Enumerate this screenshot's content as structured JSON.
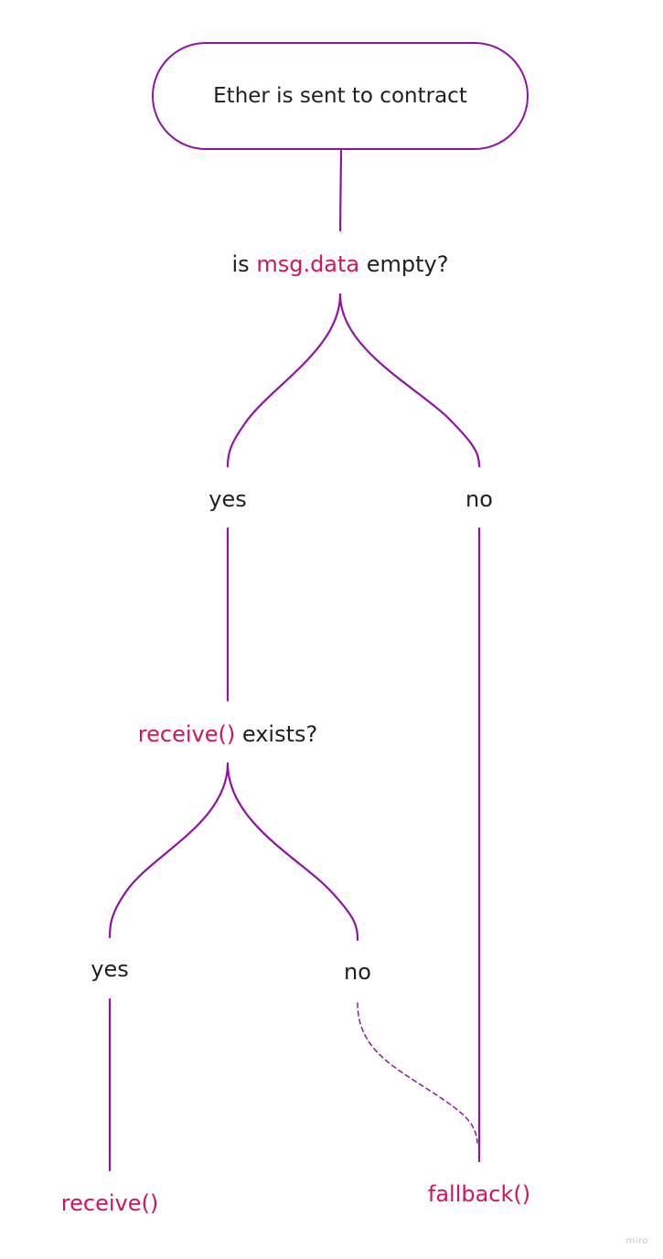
{
  "colors": {
    "connector": "#9013a6",
    "code_text": "#d4135f",
    "plain_text": "#1f1f1f",
    "watermark": "#c5c5c5"
  },
  "start": {
    "label": "Ether is sent to contract"
  },
  "question1": {
    "prefix": "is ",
    "code": "msg.data",
    "suffix": " empty?"
  },
  "branch1": {
    "yes_label": "yes",
    "no_label": "no"
  },
  "question2": {
    "code": "receive()",
    "suffix": " exists?"
  },
  "branch2": {
    "yes_label": "yes",
    "no_label": "no"
  },
  "outcomes": {
    "receive_label": "receive()",
    "fallback_label": "fallback()"
  },
  "watermark": "miro"
}
